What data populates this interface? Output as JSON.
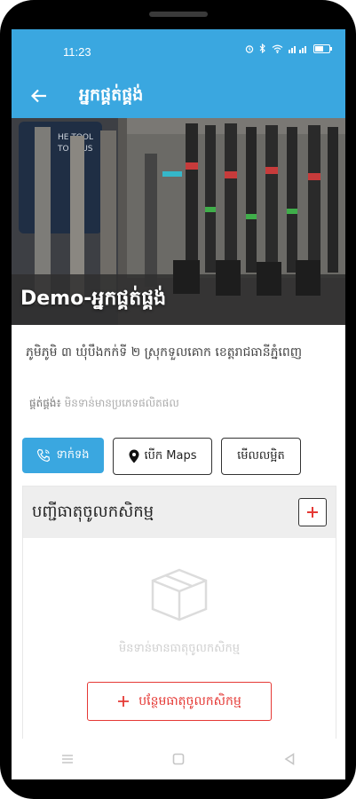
{
  "status": {
    "time": "11:23"
  },
  "appbar": {
    "title": "អ្នកផ្គត់ផ្គង់"
  },
  "hero": {
    "title": "Demo-អ្នកផ្គត់ផ្គង់"
  },
  "info": {
    "address": "ភូមិភូមិ ៣ ឃុំបឹងកក់ទី ២ ស្រុកទួលគោក ខេត្តរាជធានីភ្នំពេញ",
    "supplier_type_label": "ផ្គត់ផ្គង់៖",
    "supplier_type_value": "មិនទាន់មានប្រភេទផលិតផល"
  },
  "buttons": {
    "call": "ទាក់ទង",
    "maps": "បើក Maps",
    "details": "មើលលម្អិត"
  },
  "inputs_list": {
    "title": "បញ្ជីធាតុចូលកសិកម្ម",
    "empty_text": "មិនទាន់មានធាតុចូលកសិកម្ម",
    "add_button": "បន្ថែមធាតុចូលកសិកម្ម"
  },
  "colors": {
    "accent": "#3aa7e0",
    "danger": "#e53935"
  }
}
